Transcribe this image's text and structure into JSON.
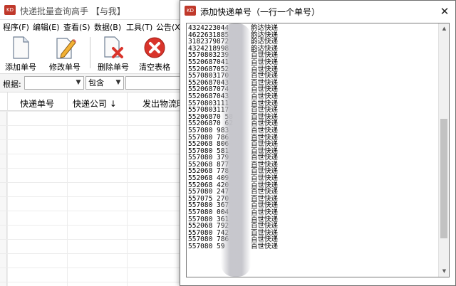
{
  "main_window": {
    "title": "快递批量查询高手 【与我】",
    "menu": [
      "程序(F)",
      "编辑(E)",
      "查看(S)",
      "数据(B)",
      "工具(T)",
      "公告(X)"
    ],
    "toolbar": {
      "add_label": "添加单号",
      "edit_label": "修改单号",
      "delete_label": "删除单号",
      "clear_label": "清空表格"
    },
    "filter": {
      "label": "根据:",
      "field_value": "",
      "match_value": "包含",
      "text_value": ""
    },
    "columns": [
      "快递单号",
      "快递公司 ↓",
      "发出物流时"
    ]
  },
  "dialog": {
    "title": "添加快递单号（一行一个单号）",
    "close_glyph": "✕",
    "lines": [
      {
        "number": "4324223044",
        "carrier": "韵达快递"
      },
      {
        "number": "4622631885",
        "carrier": "韵达快递"
      },
      {
        "number": "3182379872",
        "carrier": "韵达快递"
      },
      {
        "number": "4324218998",
        "carrier": "韵达快递"
      },
      {
        "number": "5570803239",
        "carrier": "百世快递"
      },
      {
        "number": "5520687041",
        "carrier": "百世快递"
      },
      {
        "number": "5520687052",
        "carrier": "百世快递"
      },
      {
        "number": "5570803170",
        "carrier": "百世快递"
      },
      {
        "number": "5520687043",
        "carrier": "百世快递"
      },
      {
        "number": "5520687074",
        "carrier": "百世快递"
      },
      {
        "number": "5520687043",
        "carrier": "百世快递"
      },
      {
        "number": "5570803111",
        "carrier": "百世快递"
      },
      {
        "number": "5570803117",
        "carrier": "百世快递"
      },
      {
        "number": "55206870  58",
        "carrier": "百世快递"
      },
      {
        "number": "55206870  62",
        "carrier": "百世快递"
      },
      {
        "number": "557080   983",
        "carrier": "百世快递"
      },
      {
        "number": "557080   786",
        "carrier": "百世快递"
      },
      {
        "number": "552068   806",
        "carrier": "百世快递"
      },
      {
        "number": "557080   581",
        "carrier": "百世快递"
      },
      {
        "number": "557080   379",
        "carrier": "百世快递"
      },
      {
        "number": "552068   877",
        "carrier": "百世快递"
      },
      {
        "number": "552068   778",
        "carrier": "百世快递"
      },
      {
        "number": "552068   409",
        "carrier": "百世快递"
      },
      {
        "number": "552068   420",
        "carrier": "百世快递"
      },
      {
        "number": "557080   247",
        "carrier": "百世快递"
      },
      {
        "number": "557075   270",
        "carrier": "百世快递"
      },
      {
        "number": "557080   367",
        "carrier": "百世快递"
      },
      {
        "number": "557080   004",
        "carrier": "百世快递"
      },
      {
        "number": "557080   361",
        "carrier": "百世快递"
      },
      {
        "number": "552068   792",
        "carrier": "百世快递"
      },
      {
        "number": "557080   742",
        "carrier": "百世快递"
      },
      {
        "number": "557080   786",
        "carrier": "百世快递"
      },
      {
        "number": "557080   59",
        "carrier": "百世快递"
      }
    ]
  },
  "colors": {
    "delete_icon_red": "#d9342b",
    "app_icon_red": "#c0392b"
  },
  "icons": {
    "app": "app-logo-icon",
    "add": "document-icon",
    "edit": "pencil-document-icon",
    "delete": "document-delete-icon",
    "clear": "clear-x-icon"
  }
}
